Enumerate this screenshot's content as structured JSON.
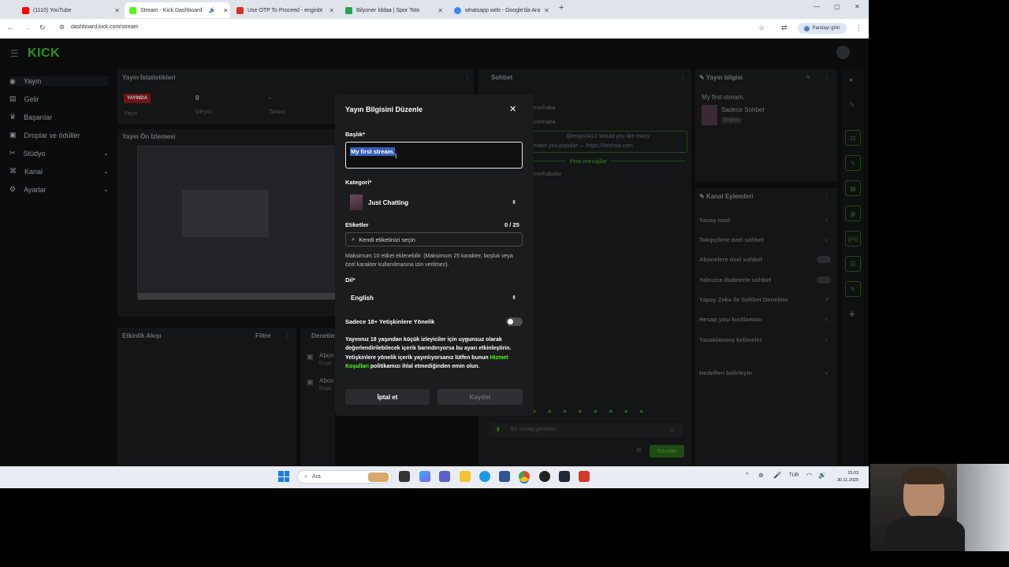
{
  "browser": {
    "tabs": [
      {
        "title": "(1110) YouTube",
        "color": "#ff0000"
      },
      {
        "title": "Stream - Kick Dashboard",
        "color": "#53fc18"
      },
      {
        "title": "Use OTP To Proceed - enginbt",
        "color": "#d93025"
      },
      {
        "title": "Bilyoner İddaa | Spor Toto",
        "color": "#1da851"
      },
      {
        "title": "whatsapp web - Google'da Ara",
        "color": "#4285f4"
      }
    ],
    "url": "dashboard.kick.com/stream",
    "password_button": "Parolayı girin"
  },
  "sidebar": {
    "logo": "KICK",
    "items": [
      {
        "label": "Yayın",
        "icon": "broadcast-icon"
      },
      {
        "label": "Gelir",
        "icon": "money-icon"
      },
      {
        "label": "Başarılar",
        "icon": "trophy-icon"
      },
      {
        "label": "Droplar ve ödüller",
        "icon": "gift-icon"
      },
      {
        "label": "Stüdyo",
        "icon": "studio-icon"
      },
      {
        "label": "Kanal",
        "icon": "channel-icon"
      },
      {
        "label": "Ayarlar",
        "icon": "gear-icon"
      }
    ]
  },
  "dashboard": {
    "stats_title": "Yayın İstatistikleri",
    "live_badge": "YAYINDA",
    "stat_viewers_value": "0",
    "stat_viewers_label": "İzleyici",
    "stat_followers_value": "-",
    "stat_followers_label": "Takipçi",
    "stat_stream_label": "Yayın",
    "preview_title": "Yayın Ön İzlemesi",
    "activity_title": "Etkinlik Akışı",
    "activity_filter": "Filtre",
    "moderation_title": "Denetim",
    "abone_label": "Abon",
    "engin_label": "Engin",
    "chat_title": "Sohbet",
    "chat_messages": [
      "merhaba",
      "merhaba",
      "@engin3412 Would you like many",
      "make you popular — https://hezhna.com",
      "merhabalar"
    ],
    "new_messages": "Yeni mesajlar",
    "chat_placeholder": "Bir mesaj gönderin",
    "send_button": "Gönder",
    "info_title": "Yayın bilgisi",
    "info_stream_title": "My first stream.",
    "info_category": "Sadece Sohbet",
    "info_language": "English",
    "actions_title": "Kanal Eylemleri",
    "actions": [
      "Yavaş mod",
      "Takipçilere özel sohbet",
      "Abonelere özel sohbet",
      "Yalnızca ifadelerle sohbet",
      "Yapay Zeka ile Sohbet Denetimi",
      "Hesap yaşı kısıtlaması",
      "Yasaklanmış kelimeler",
      "Hedefleri belirleyin"
    ]
  },
  "modal": {
    "title": "Yayın Bilgisini Düzenle",
    "title_label": "Başlık*",
    "title_value": "My first stream.",
    "category_label": "Kategori*",
    "category_value": "Just Chatting",
    "tags_label": "Etiketler",
    "tags_count": "0 / 25",
    "tags_placeholder": "Kendi etiketinizi seçin",
    "tags_help": "Maksimum 10 etiket eklenebilir. (Maksimum 25 karakter, boşluk veya özel karakter kullanılmasına izin verilmez).",
    "language_label": "Dil*",
    "language_value": "English",
    "adult_label": "Sadece 18+ Yetişkinlere Yönelik",
    "adult_enabled": false,
    "warning_part1": "Yayınınız 18 yaşından küçük izleyiciler için uygunsuz olarak değerlendirilebilecek içerik barındırıyorsa bu ayarı etkinleştirin. Yetişkinlere yönelik içerik yayınlıyorsanız lütfen bunun ",
    "warning_link": "Hizmet Koşulları",
    "warning_part2": " politikamızı ihlal etmediğinden emin olun.",
    "cancel_button": "İptal et",
    "save_button": "Kaydet"
  },
  "taskbar": {
    "search_placeholder": "Ara",
    "language": "TUR",
    "time": "15:03",
    "date": "30.11.2025"
  }
}
